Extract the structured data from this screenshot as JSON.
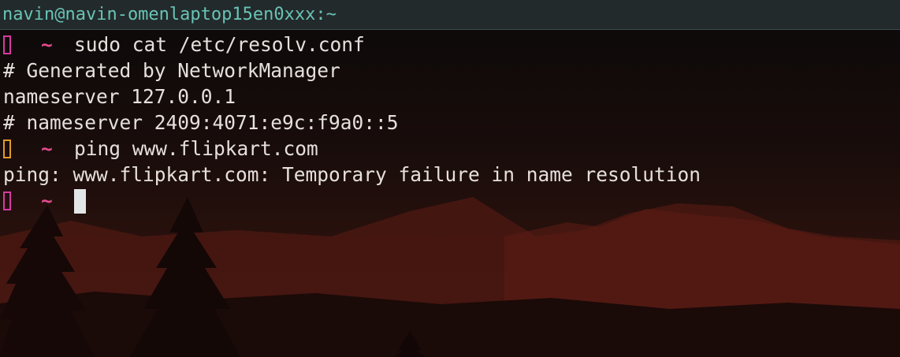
{
  "window": {
    "title": "navin@navin-omenlaptop15en0xxx:~"
  },
  "prompt": {
    "dir_symbol": "~",
    "status_ok_color": "#d63aa0",
    "status_error_color": "#e09a2c",
    "status_icon": "missing-glyph-box"
  },
  "lines": {
    "cmd1": "sudo cat /etc/resolv.conf",
    "out1": "# Generated by NetworkManager",
    "out2": "nameserver 127.0.0.1",
    "out3": "# nameserver 2409:4071:e9c:f9a0::5",
    "cmd2": "ping www.flipkart.com",
    "out4": "ping: www.flipkart.com: Temporary failure in name resolution"
  }
}
